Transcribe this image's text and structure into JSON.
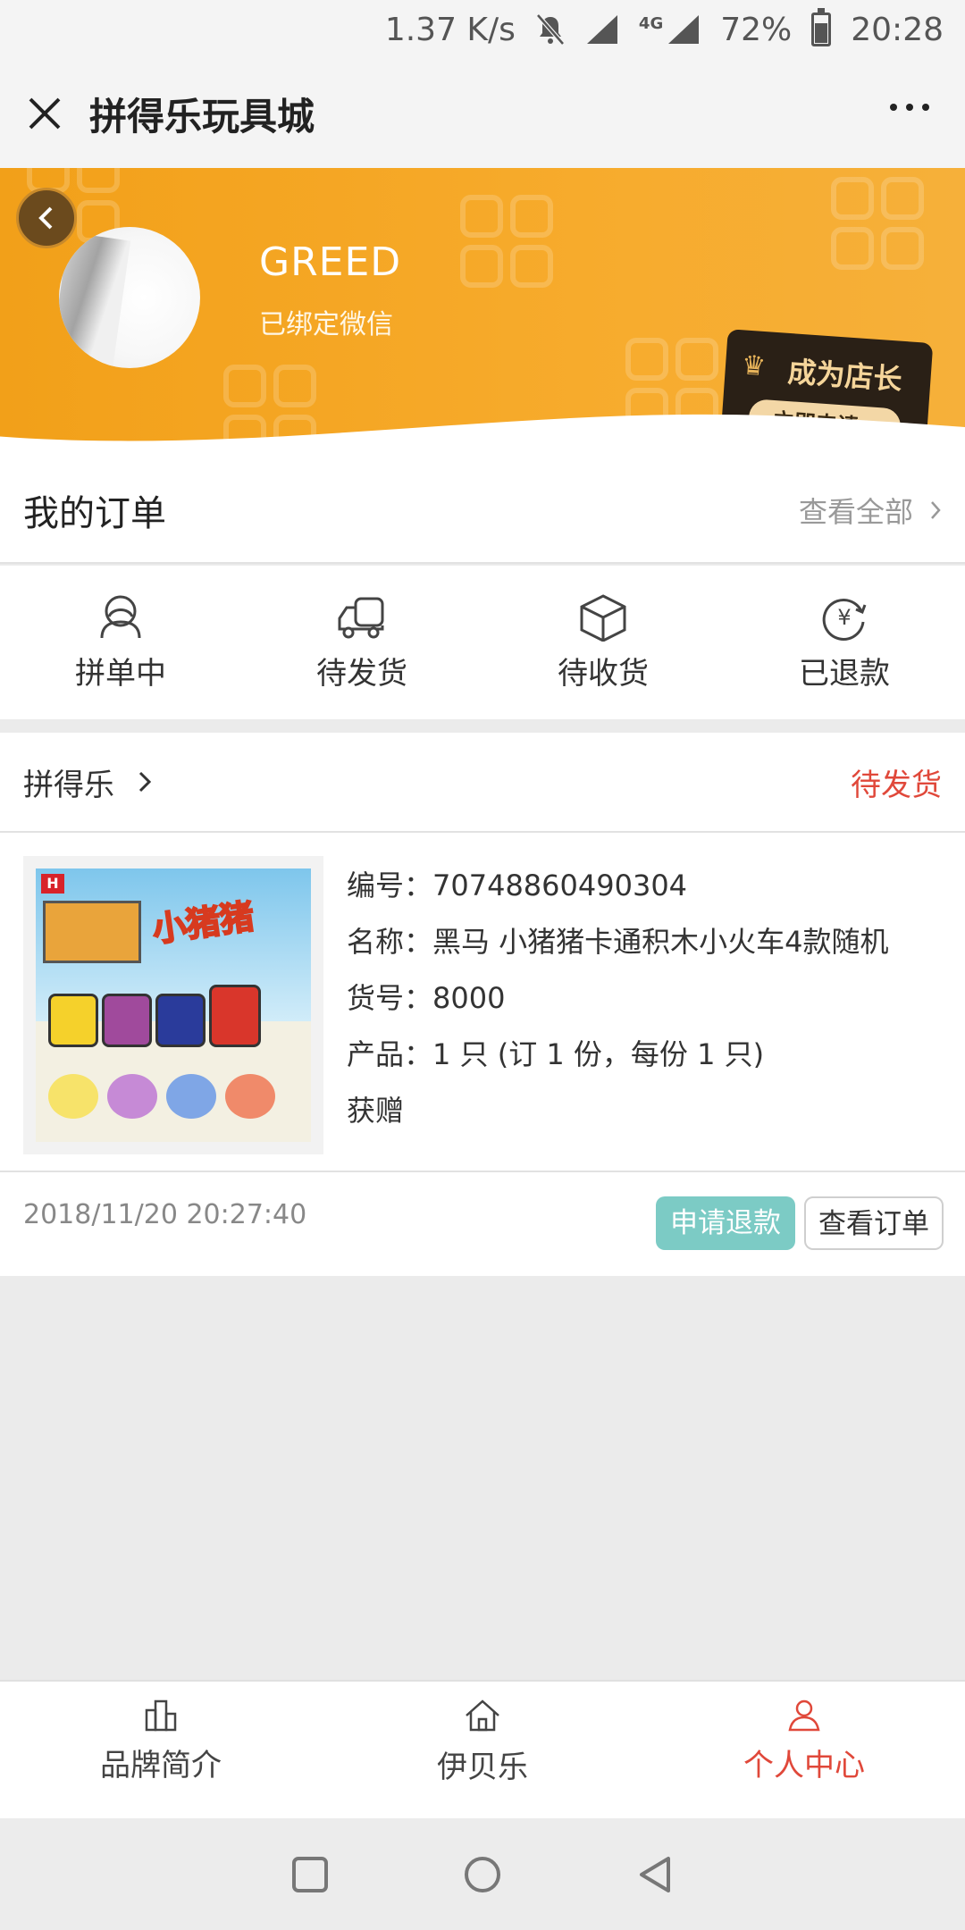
{
  "status_bar": {
    "speed": "1.37 K/s",
    "network": "4G",
    "battery": "72%",
    "time": "20:28"
  },
  "titlebar": {
    "title": "拼得乐玩具城"
  },
  "profile": {
    "username": "GREED",
    "wechat_status": "已绑定微信"
  },
  "promo": {
    "title": "成为店长",
    "button": "立即申请>"
  },
  "orders": {
    "heading": "我的订单",
    "view_all": "查看全部"
  },
  "order_tabs": [
    {
      "label": "拼单中",
      "icon": "group-icon"
    },
    {
      "label": "待发货",
      "icon": "truck-icon"
    },
    {
      "label": "待收货",
      "icon": "box-icon"
    },
    {
      "label": "已退款",
      "icon": "refund-icon"
    }
  ],
  "order_card": {
    "shop_name": "拼得乐",
    "status": "待发货",
    "product_image_text": "小猪猪",
    "lines": [
      "编号：70748860490304",
      "名称：黑马 小猪猪卡通积木小火车4款随机",
      "货号：8000",
      "产品：1 只 (订 1 份，每份 1 只)",
      "获赠"
    ],
    "time": "2018/11/20 20:27:40",
    "refund_button": "申请退款",
    "view_button": "查看订单"
  },
  "bottom_nav": [
    {
      "label": "品牌简介",
      "icon": "building-icon",
      "active": false
    },
    {
      "label": "伊贝乐",
      "icon": "home-icon",
      "active": false
    },
    {
      "label": "个人中心",
      "icon": "person-icon",
      "active": true
    }
  ],
  "colors": {
    "brand_orange": "#f2a019",
    "accent_red": "#e0483a",
    "teal": "#7ccbc5"
  }
}
